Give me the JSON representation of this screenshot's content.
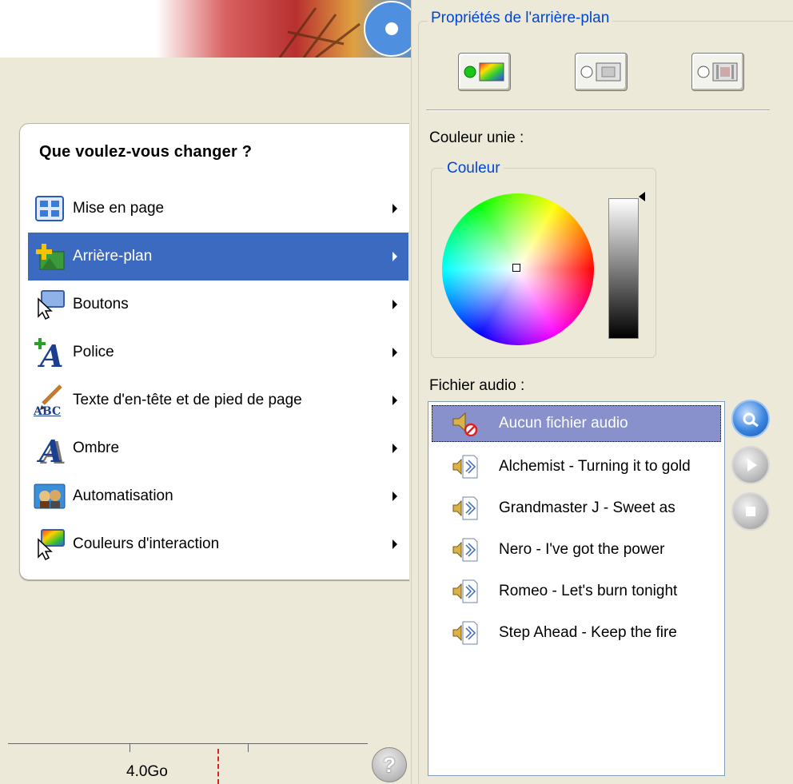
{
  "menu": {
    "title": "Que voulez-vous changer ?",
    "items": [
      {
        "label": "Mise en page",
        "icon": "layout-icon",
        "selected": false
      },
      {
        "label": "Arrière-plan",
        "icon": "background-icon",
        "selected": true
      },
      {
        "label": "Boutons",
        "icon": "buttons-icon",
        "selected": false
      },
      {
        "label": "Police",
        "icon": "font-icon",
        "selected": false
      },
      {
        "label": "Texte d'en-tête et de pied de page",
        "icon": "header-footer-text-icon",
        "selected": false
      },
      {
        "label": "Ombre",
        "icon": "shadow-icon",
        "selected": false
      },
      {
        "label": "Automatisation",
        "icon": "automation-icon",
        "selected": false
      },
      {
        "label": "Couleurs d'interaction",
        "icon": "interaction-colors-icon",
        "selected": false
      }
    ]
  },
  "status": {
    "capacity_label": "4.0Go"
  },
  "help": {
    "symbol": "?"
  },
  "properties": {
    "title": "Propriétés de l'arrière-plan",
    "modes": [
      "solid-color-mode",
      "image-mode",
      "video-mode"
    ],
    "selected_mode": "solid-color-mode",
    "solid_color_label": "Couleur unie :",
    "color_group_label": "Couleur"
  },
  "audio": {
    "label": "Fichier audio :",
    "files": [
      {
        "name": "Aucun fichier audio",
        "selected": true,
        "icon": "no-audio-icon"
      },
      {
        "name": "Alchemist - Turning it to gold",
        "selected": false,
        "icon": "audio-file-icon"
      },
      {
        "name": "Grandmaster J - Sweet as",
        "selected": false,
        "icon": "audio-file-icon"
      },
      {
        "name": "Nero -  I've got the power",
        "selected": false,
        "icon": "audio-file-icon"
      },
      {
        "name": "Romeo -  Let's burn tonight",
        "selected": false,
        "icon": "audio-file-icon"
      },
      {
        "name": "Step Ahead - Keep the fire",
        "selected": false,
        "icon": "audio-file-icon"
      }
    ]
  },
  "colors": {
    "selection": "#3b6ac0",
    "audio_selection": "#8891cc",
    "legend": "#0046d5",
    "panel": "#ece9d8"
  }
}
